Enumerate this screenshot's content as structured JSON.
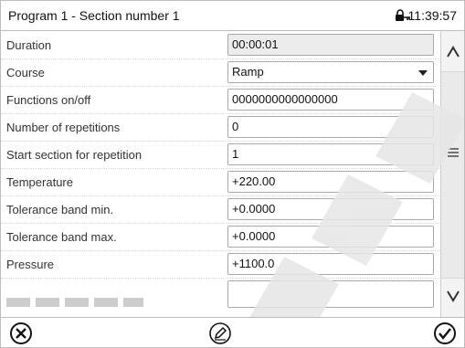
{
  "header": {
    "title": "Program 1 - Section number 1",
    "time": "11:39:57"
  },
  "rows": [
    {
      "label": "Duration",
      "value": "00:00:01"
    },
    {
      "label": "Course",
      "value": "Ramp"
    },
    {
      "label": "Functions on/off",
      "value": "0000000000000000"
    },
    {
      "label": "Number of repetitions",
      "value": "0"
    },
    {
      "label": "Start section for repetition",
      "value": "1"
    },
    {
      "label": "Temperature",
      "value": "+220.00"
    },
    {
      "label": "Tolerance band min.",
      "value": "+0.0000"
    },
    {
      "label": "Tolerance band max.",
      "value": "+0.0000"
    },
    {
      "label": "Pressure",
      "value": "+1100.0"
    }
  ],
  "icons": {
    "lock": "lock-icon",
    "scroll_up": "chevron-up-icon",
    "scroll_grip": "menu-grip-icon",
    "scroll_down": "chevron-down-icon",
    "cancel": "cancel-circle-icon",
    "edit": "edit-pencil-icon",
    "confirm": "confirm-check-icon",
    "watermark_color": "#e6e6e6"
  }
}
